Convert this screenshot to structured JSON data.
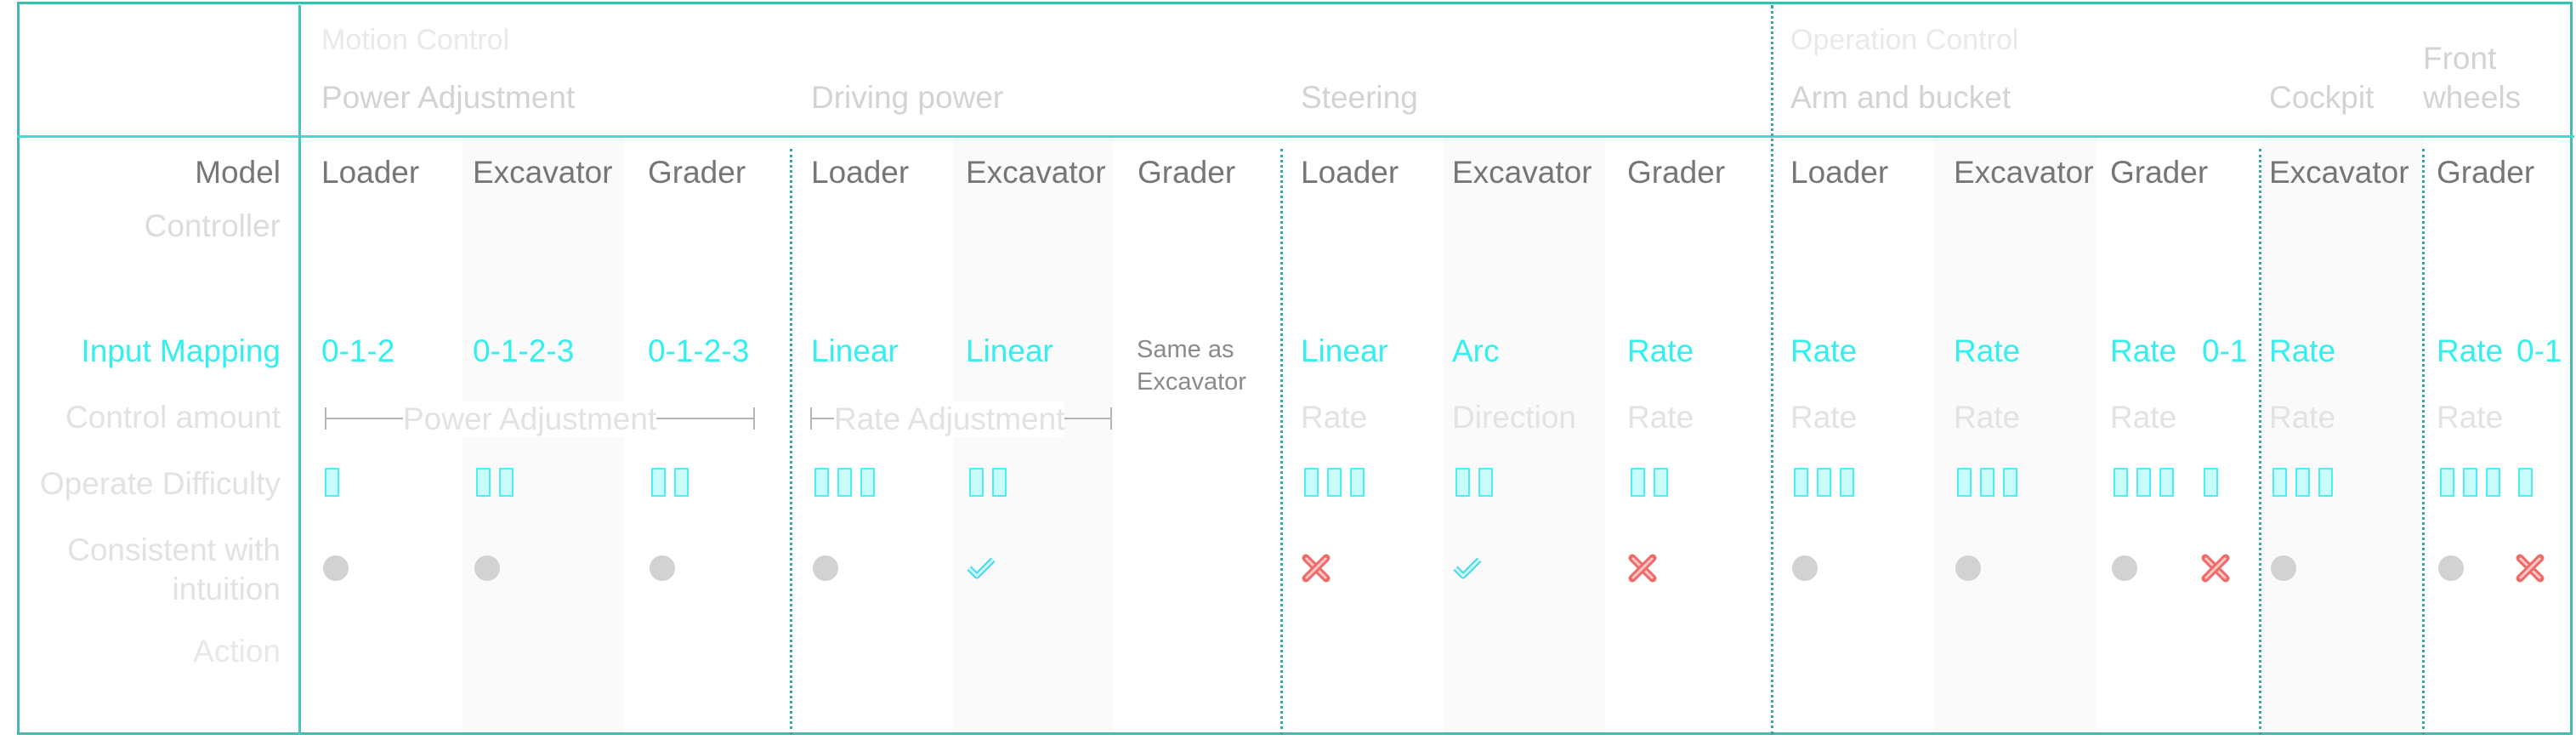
{
  "header": {
    "motion_control": "Motion Control",
    "operation_control": "Operation Control",
    "sub_power": "Power Adjustment",
    "sub_driving": "Driving power",
    "sub_steering": "Steering",
    "sub_arm": "Arm and bucket",
    "sub_cockpit": "Cockpit",
    "sub_front_1": "Front",
    "sub_front_2": "wheels"
  },
  "rows": {
    "model": "Model",
    "controller": "Controller",
    "input_mapping": "Input Mapping",
    "control_amount": "Control amount",
    "operate_difficulty": "Operate Difficulty",
    "consistent_1": "Consistent with",
    "consistent_2": "intuition",
    "action": "Action"
  },
  "columns": [
    {
      "model": "Loader",
      "mapping": "0-1-2",
      "amount": "",
      "difficulty": 1,
      "consistent": [
        "neutral"
      ]
    },
    {
      "model": "Excavator",
      "mapping": "0-1-2-3",
      "amount": "",
      "difficulty": 2,
      "consistent": [
        "neutral"
      ]
    },
    {
      "model": "Grader",
      "mapping": "0-1-2-3",
      "amount": "",
      "difficulty": 2,
      "consistent": [
        "neutral"
      ]
    },
    {
      "model": "Loader",
      "mapping": "Linear",
      "amount": "",
      "difficulty": 3,
      "consistent": [
        "neutral"
      ]
    },
    {
      "model": "Excavator",
      "mapping": "Linear",
      "amount": "",
      "difficulty": 2,
      "consistent": [
        "yes"
      ]
    },
    {
      "model": "Grader",
      "mapping": "",
      "amount": "",
      "difficulty": 0,
      "consistent": []
    },
    {
      "model": "Loader",
      "mapping": "Linear",
      "amount": "Rate",
      "difficulty": 3,
      "consistent": [
        "no"
      ]
    },
    {
      "model": "Excavator",
      "mapping": "Arc",
      "amount": "Direction",
      "difficulty": 2,
      "consistent": [
        "yes"
      ]
    },
    {
      "model": "Grader",
      "mapping": "Rate",
      "amount": "Rate",
      "difficulty": 2,
      "consistent": [
        "no"
      ]
    },
    {
      "model": "Loader",
      "mapping": "Rate",
      "amount": "Rate",
      "difficulty": 3,
      "consistent": [
        "neutral"
      ]
    },
    {
      "model": "Excavator",
      "mapping": "Rate",
      "amount": "Rate",
      "difficulty": 3,
      "consistent": [
        "neutral"
      ]
    },
    {
      "model": "Grader",
      "mapping": "Rate",
      "mapping2": "0-1",
      "amount": "Rate",
      "difficulty": 3,
      "difficulty2": 1,
      "consistent": [
        "neutral",
        "no"
      ]
    },
    {
      "model": "Excavator",
      "mapping": "Rate",
      "amount": "Rate",
      "difficulty": 3,
      "consistent": [
        "neutral"
      ]
    },
    {
      "model": "Grader",
      "mapping": "Rate",
      "mapping2": "0-1",
      "amount": "Rate",
      "difficulty": 3,
      "difficulty2": 1,
      "consistent": [
        "neutral",
        "no"
      ]
    }
  ],
  "spans": {
    "power_adjustment": "Power Adjustment",
    "rate_adjustment": "Rate Adjustment"
  },
  "same_as": "Same as Excavator",
  "colors": {
    "frame": "#45b9ab",
    "mapping": "#33f0f0",
    "difficulty_bar": "#49f2f2",
    "neutral_dot": "#d2d2d2",
    "check": "#49d6f0",
    "cross": "#f06a6a"
  },
  "icons": {
    "yes": "check-icon",
    "no": "cross-icon",
    "neutral": "neutral-dot-icon"
  }
}
